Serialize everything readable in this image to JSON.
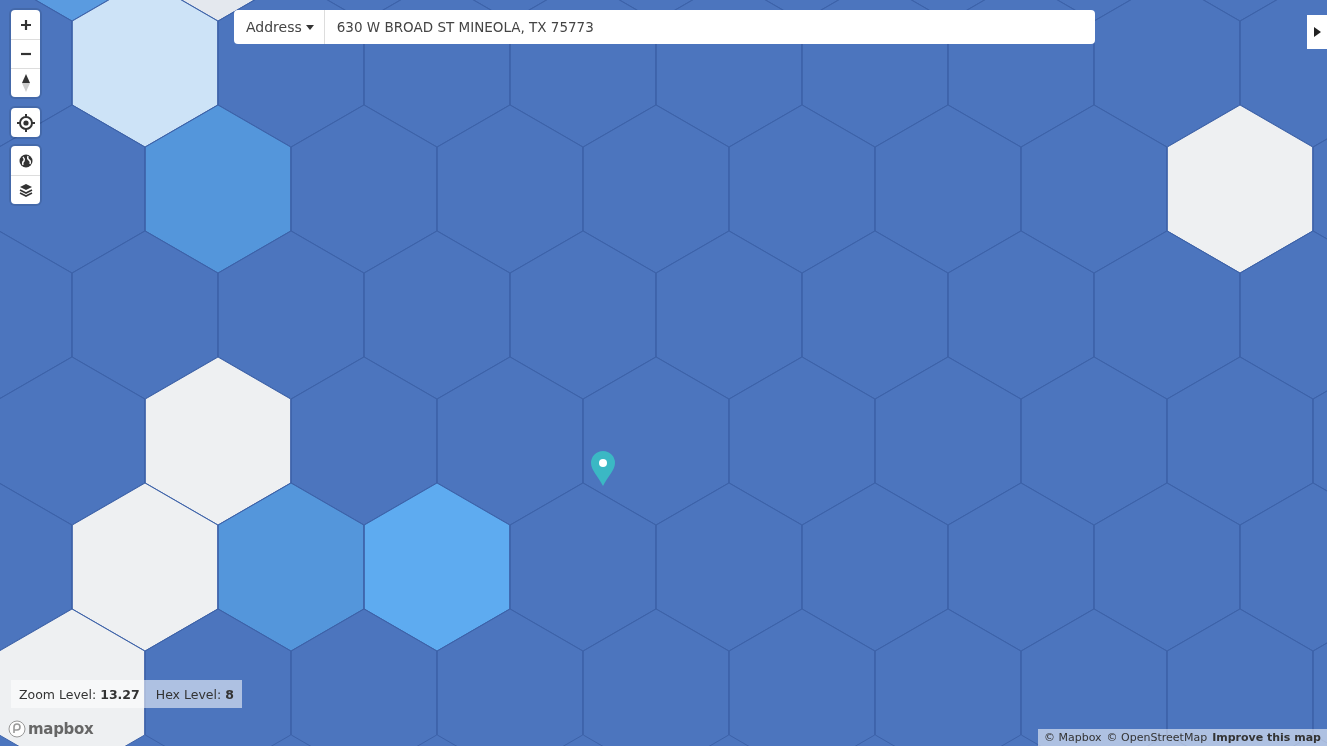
{
  "address_search": {
    "mode_label": "Address",
    "value": "630 W BROAD ST MINEOLA, TX 75773"
  },
  "map_status": {
    "zoom": "Zoom Level: **13.27**",
    "hex": "Hex Level: **8**"
  },
  "logo": "mapbox",
  "attribution": {
    "links": [
      "© Mapbox",
      "© OpenStreetMap"
    ],
    "improve": "Improve this map"
  }
}
